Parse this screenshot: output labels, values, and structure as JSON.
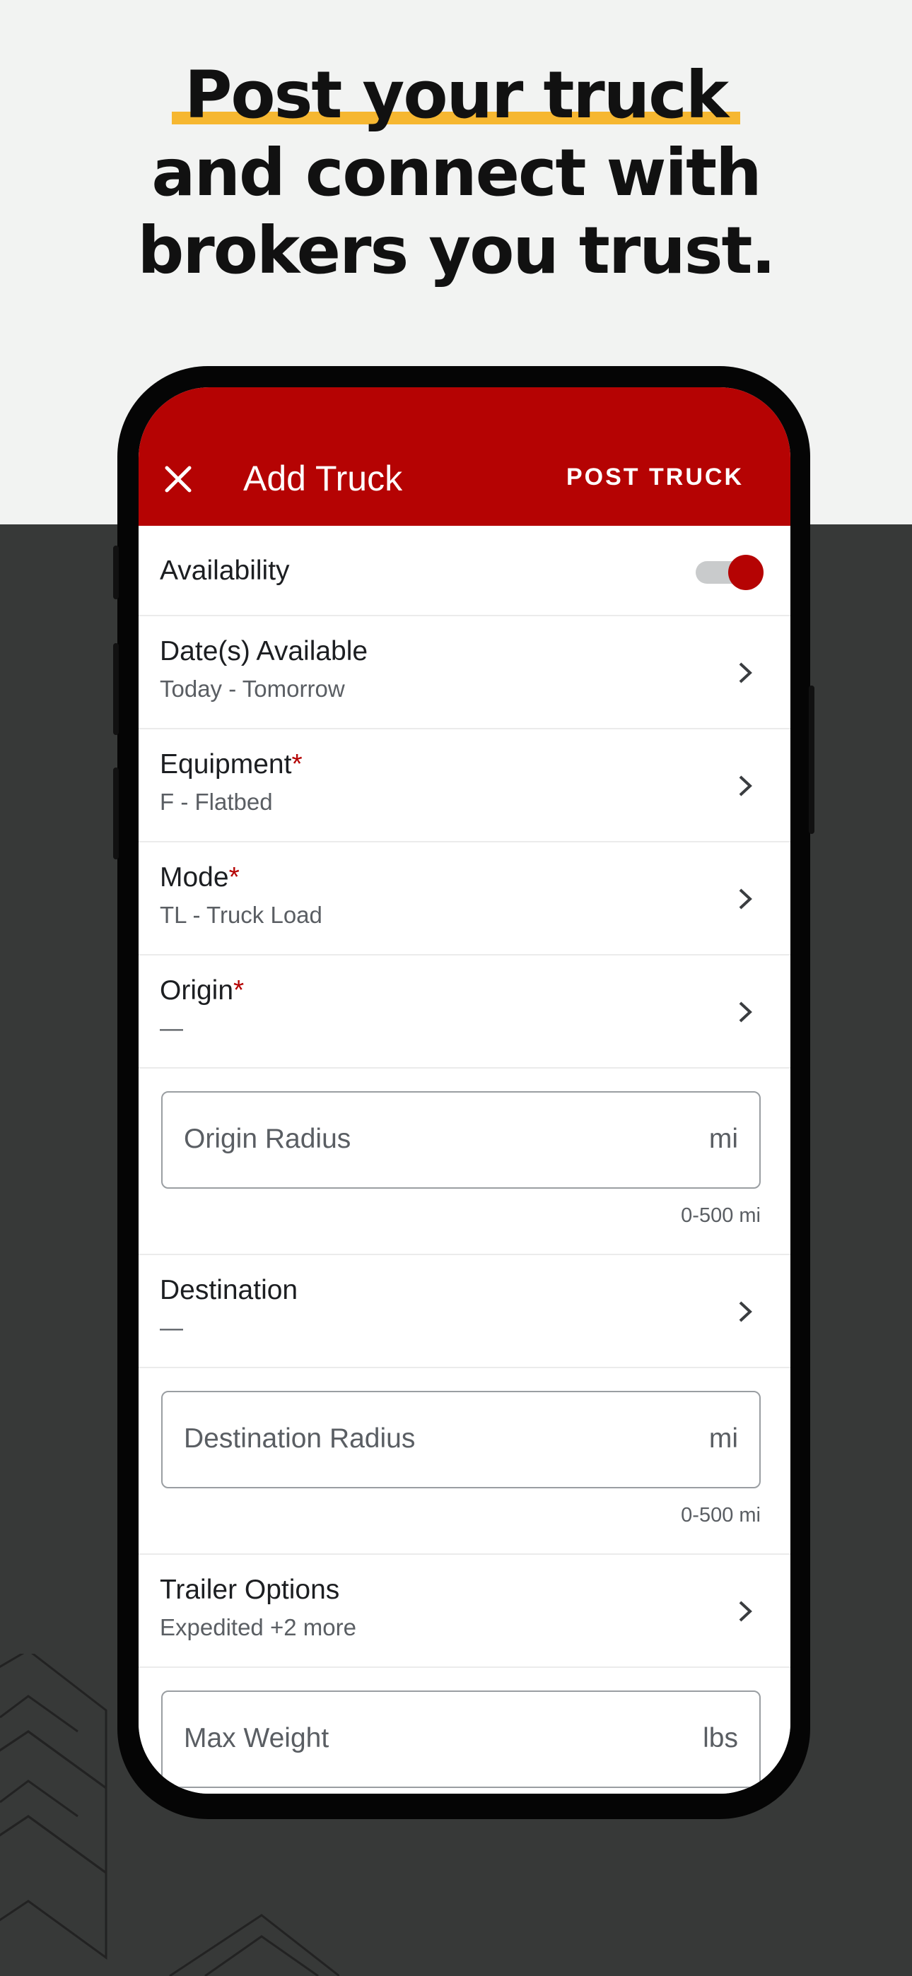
{
  "headline": {
    "line1": "Post your truck",
    "line2": "and connect with",
    "line3": "brokers you trust.",
    "underline_color": "#f6b731"
  },
  "appbar": {
    "close_icon": "close-icon",
    "title": "Add Truck",
    "action": "POST TRUCK",
    "color": "#b50303"
  },
  "availability": {
    "label": "Availability",
    "enabled": true
  },
  "dates": {
    "label": "Date(s) Available",
    "value": "Today - Tomorrow"
  },
  "equipment": {
    "label": "Equipment",
    "required_mark": "*",
    "value": "F - Flatbed"
  },
  "mode": {
    "label": "Mode",
    "required_mark": "*",
    "value": "TL - Truck Load"
  },
  "origin": {
    "label": "Origin",
    "required_mark": "*",
    "value": "—"
  },
  "origin_radius": {
    "placeholder": "Origin Radius",
    "unit": "mi",
    "helper": "0-500 mi"
  },
  "destination": {
    "label": "Destination",
    "value": "—"
  },
  "destination_radius": {
    "placeholder": "Destination Radius",
    "unit": "mi",
    "helper": "0-500 mi"
  },
  "trailer": {
    "label": "Trailer Options",
    "value": "Expedited +2 more"
  },
  "max_weight": {
    "placeholder": "Max Weight",
    "unit": "lbs"
  }
}
